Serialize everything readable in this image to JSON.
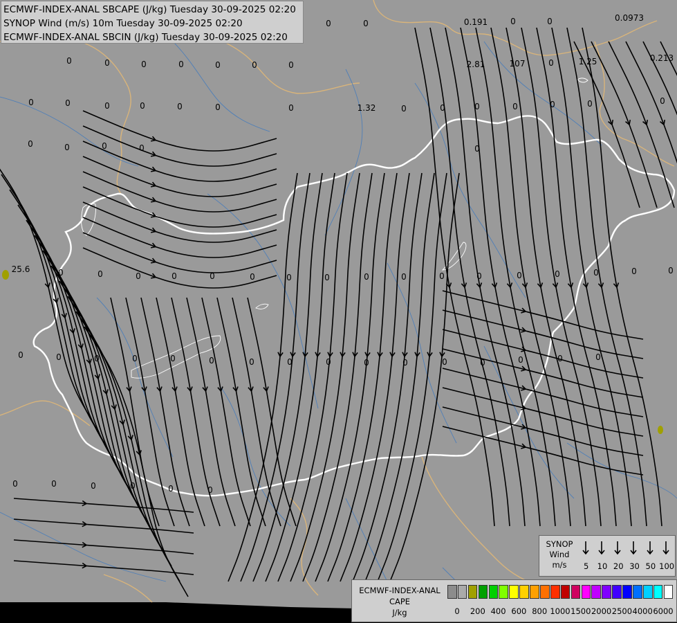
{
  "title": {
    "line1": "ECMWF-INDEX-ANAL SBCAPE (J/kg) Tuesday 30-09-2025 02:20",
    "line2": "SYNOP Wind (m/s) 10m Tuesday 30-09-2025 02:20",
    "line3": "ECMWF-INDEX-ANAL SBCIN (J/kg) Tuesday 30-09-2025 02:20"
  },
  "colors": {
    "background": "#9a9a9a",
    "country_border": "#ffffff",
    "region_border": "#d9b47a",
    "river": "#4f7fb8",
    "streamline": "#000000",
    "no_data": "#000000"
  },
  "map_values": [
    "0",
    "0",
    "0",
    "0",
    "0.191",
    "0",
    "0",
    "0.0973",
    "0",
    "0",
    "0",
    "0",
    "0",
    "0",
    "0",
    "2.81",
    "107",
    "0",
    "1.25",
    "0.213",
    "0",
    "0",
    "0",
    "0",
    "0",
    "0",
    "0",
    "1.32",
    "0",
    "0",
    "0",
    "0",
    "0",
    "0",
    "0",
    "0",
    "0",
    "0",
    "0",
    "0",
    "25.6",
    "0",
    "0",
    "0",
    "0",
    "0",
    "0",
    "0",
    "0",
    "0",
    "0",
    "0",
    "0",
    "0",
    "0",
    "0",
    "0",
    "0",
    "0",
    "0",
    "0",
    "0",
    "0",
    "0",
    "0",
    "0",
    "0",
    "0",
    "0",
    "0",
    "0",
    "0",
    "0",
    "0",
    "0",
    "0",
    "0",
    "0",
    "0",
    "0"
  ],
  "synop_legend": {
    "title_line1": "SYNOP",
    "title_line2": "Wind",
    "unit": "m/s",
    "speeds": [
      "5",
      "10",
      "20",
      "30",
      "50",
      "100"
    ]
  },
  "cape_legend": {
    "title_line1": "ECMWF-INDEX-ANAL",
    "title_line2": "CAPE",
    "unit": "J/kg",
    "colors": [
      "#8c8c8c",
      "#aaaaaa",
      "#a0a000",
      "#00a000",
      "#00d000",
      "#80ff00",
      "#ffff00",
      "#ffd000",
      "#ffa000",
      "#ff7000",
      "#ff3000",
      "#c00000",
      "#d00060",
      "#ff00ff",
      "#c000ff",
      "#8000ff",
      "#4000ff",
      "#0000ff",
      "#0070ff",
      "#00d0ff",
      "#00ffff",
      "#ffffff"
    ],
    "ticks": [
      "0",
      "200",
      "400",
      "600",
      "800",
      "1000",
      "1500",
      "2000",
      "2500",
      "4000",
      "6000"
    ]
  }
}
